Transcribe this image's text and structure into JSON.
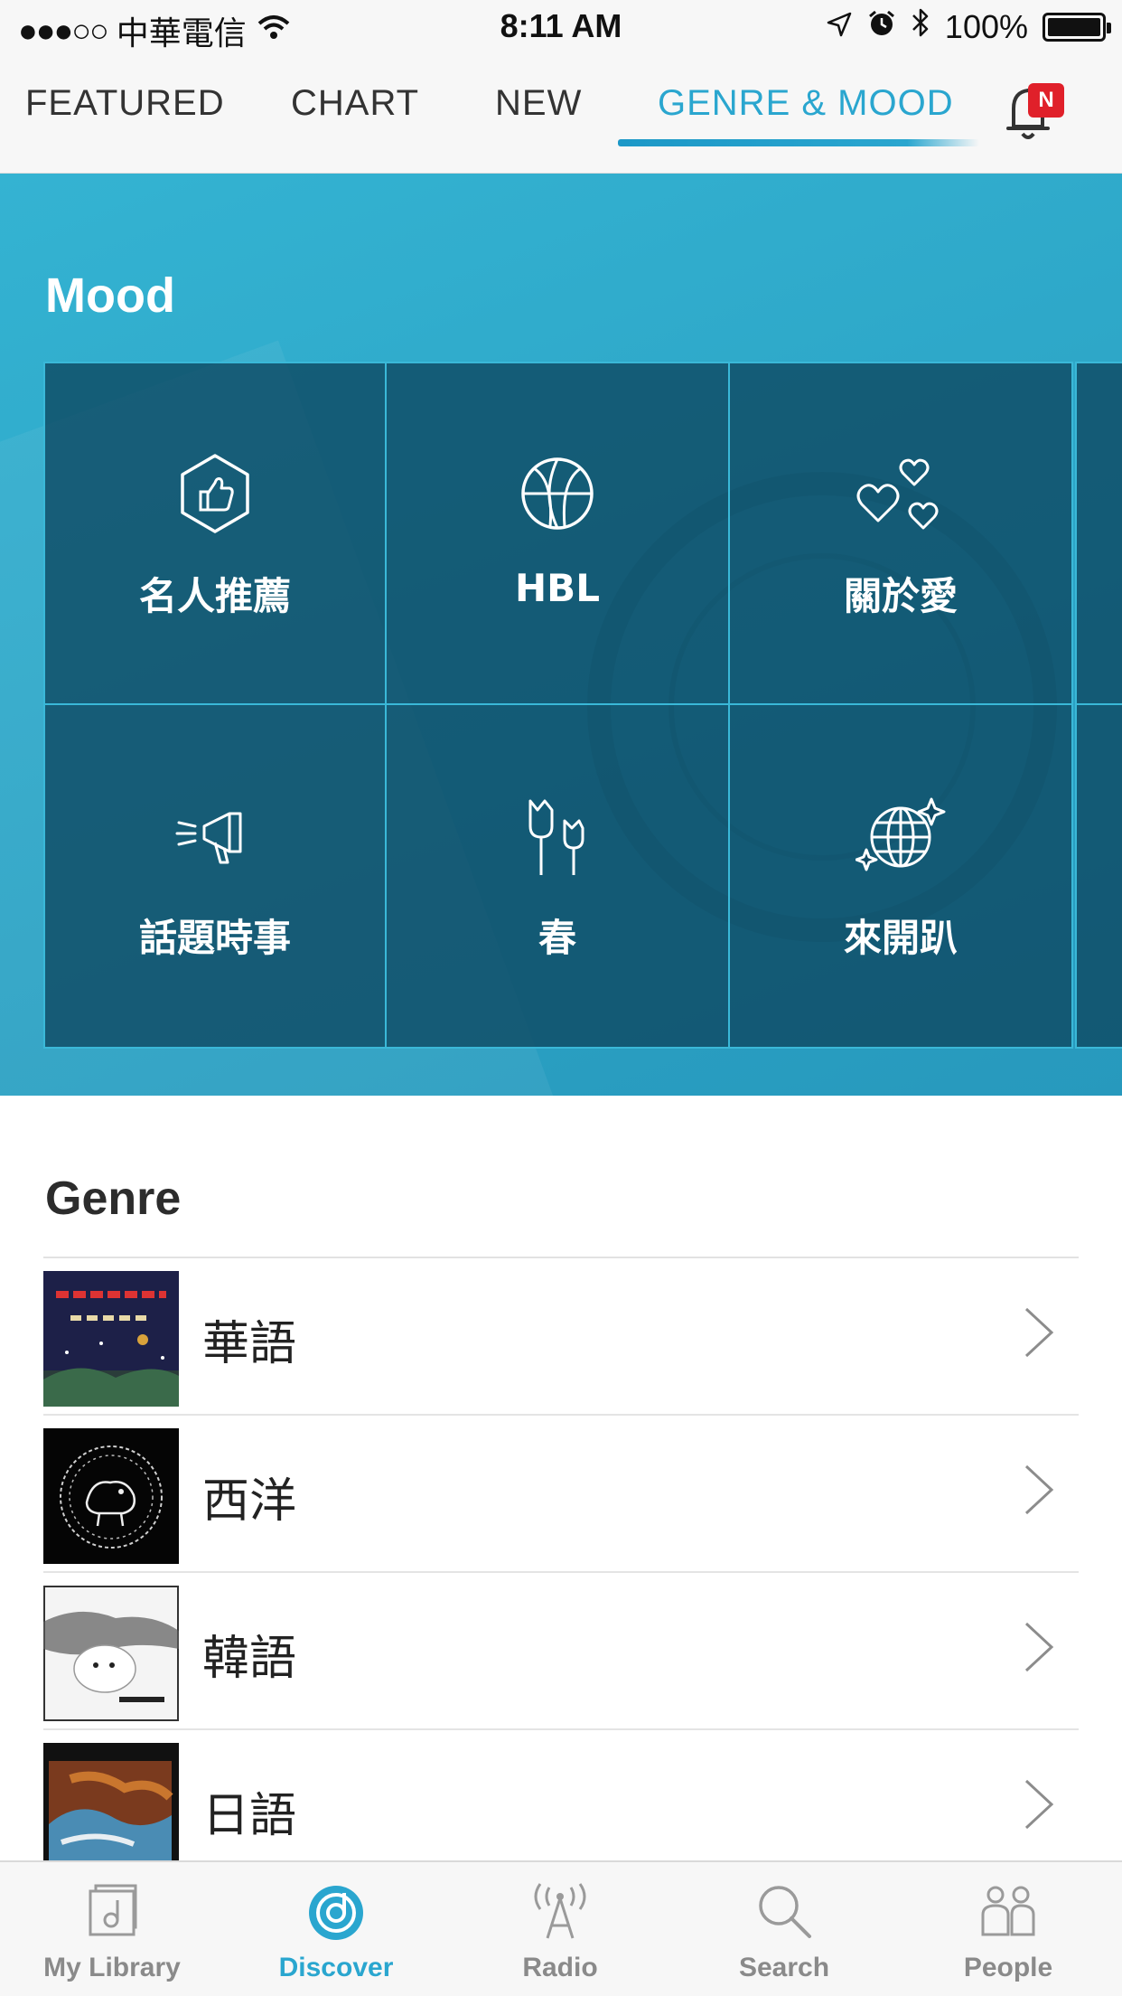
{
  "status_bar": {
    "signal": "●●●○○",
    "carrier": "中華電信",
    "time": "8:11 AM",
    "battery": "100%",
    "icons": [
      "wifi-icon",
      "location-arrow-icon",
      "alarm-icon",
      "bluetooth-icon",
      "battery-icon"
    ]
  },
  "top_tabs": [
    {
      "label": "FEATURED",
      "active": false
    },
    {
      "label": "CHART",
      "active": false
    },
    {
      "label": "NEW",
      "active": false
    },
    {
      "label": "GENRE & MOOD",
      "active": true
    }
  ],
  "notification": {
    "icon": "bell-icon",
    "badge": "N"
  },
  "mood": {
    "title": "Mood",
    "tiles": [
      {
        "label": "名人推薦",
        "icon": "thumbs-up-hexagon-icon"
      },
      {
        "label": "HBL",
        "icon": "basketball-icon"
      },
      {
        "label": "關於愛",
        "icon": "hearts-icon"
      },
      {
        "label": "話題時事",
        "icon": "megaphone-icon"
      },
      {
        "label": "春",
        "icon": "tulip-icon"
      },
      {
        "label": "來開趴",
        "icon": "globe-sparkle-icon"
      }
    ]
  },
  "genre": {
    "title": "Genre",
    "items": [
      {
        "label": "華語",
        "thumb": "album-cover-1"
      },
      {
        "label": "西洋",
        "thumb": "album-cover-2"
      },
      {
        "label": "韓語",
        "thumb": "album-cover-3"
      },
      {
        "label": "日語",
        "thumb": "album-cover-4"
      }
    ]
  },
  "bottom_tabs": [
    {
      "label": "My Library",
      "icon": "library-icon",
      "active": false
    },
    {
      "label": "Discover",
      "icon": "discover-icon",
      "active": true
    },
    {
      "label": "Radio",
      "icon": "radio-tower-icon",
      "active": false
    },
    {
      "label": "Search",
      "icon": "search-icon",
      "active": false
    },
    {
      "label": "People",
      "icon": "people-icon",
      "active": false
    }
  ],
  "colors": {
    "accent": "#2aa6cf",
    "hero": "#2ea8c9",
    "tile": "#0e4862",
    "badge": "#e0202a"
  }
}
